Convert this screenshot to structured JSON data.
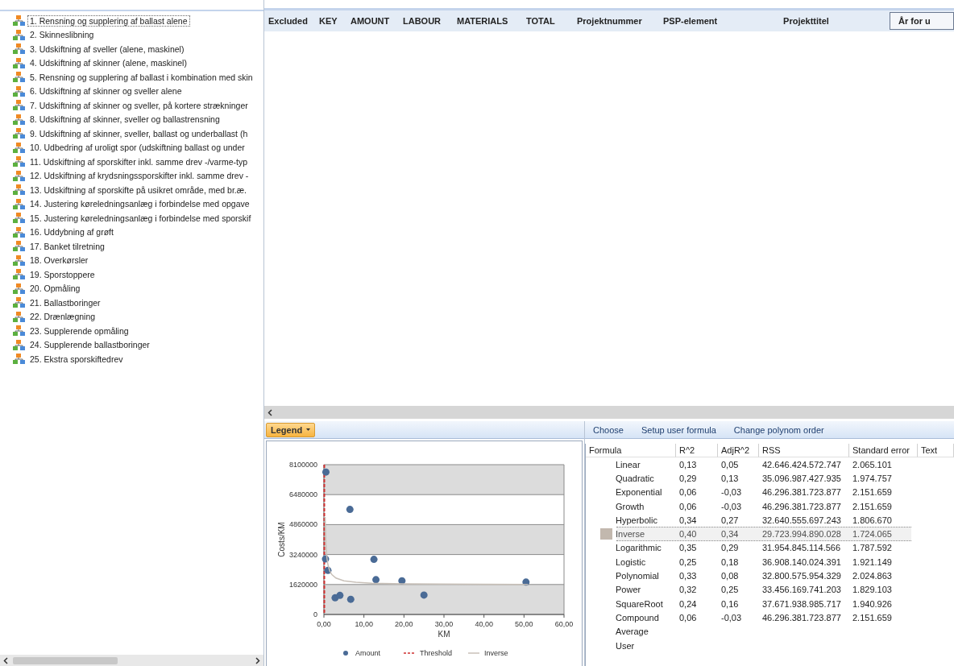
{
  "tree": {
    "items": [
      {
        "label": "1. Rensning og supplering af ballast alene",
        "selected": true
      },
      {
        "label": "2. Skinneslibning",
        "selected": false
      },
      {
        "label": "3. Udskiftning af sveller (alene, maskinel)",
        "selected": false
      },
      {
        "label": "4. Udskiftning af skinner (alene, maskinel)",
        "selected": false
      },
      {
        "label": "5. Rensning og supplering af ballast i kombination med skin",
        "selected": false
      },
      {
        "label": "6. Udskiftning af skinner og sveller alene",
        "selected": false
      },
      {
        "label": "7. Udskiftning af skinner og sveller, på kortere strækninger",
        "selected": false
      },
      {
        "label": "8. Udskiftning af skinner, sveller og ballastrensning",
        "selected": false
      },
      {
        "label": "9. Udskiftning af skinner, sveller, ballast og underballast (h",
        "selected": false
      },
      {
        "label": "10. Udbedring af uroligt spor (udskiftning ballast og under",
        "selected": false
      },
      {
        "label": "11. Udskiftning af sporskifter inkl. samme drev -/varme-typ",
        "selected": false
      },
      {
        "label": "12. Udskiftning af krydsningssporskifter inkl. samme drev -",
        "selected": false
      },
      {
        "label": "13. Udskiftning af sporskifte på usikret område, med br.æ.",
        "selected": false
      },
      {
        "label": "14. Justering køreledningsanlæg i forbindelse med opgave",
        "selected": false
      },
      {
        "label": "15. Justering køreledningsanlæg i forbindelse med sporskif",
        "selected": false
      },
      {
        "label": "16. Uddybning af grøft",
        "selected": false
      },
      {
        "label": "17. Banket tilretning",
        "selected": false
      },
      {
        "label": "18. Overkørsler",
        "selected": false
      },
      {
        "label": "19. Sporstoppere",
        "selected": false
      },
      {
        "label": "20. Opmåling",
        "selected": false
      },
      {
        "label": "21. Ballastboringer",
        "selected": false
      },
      {
        "label": "22. Drænlægning",
        "selected": false
      },
      {
        "label": "23. Supplerende opmåling",
        "selected": false
      },
      {
        "label": "24. Supplerende ballastboringer",
        "selected": false
      },
      {
        "label": "25. Ekstra sporskiftedrev",
        "selected": false
      }
    ]
  },
  "grid": {
    "columns": [
      {
        "label": "Excluded",
        "selected": false
      },
      {
        "label": "KEY",
        "selected": false
      },
      {
        "label": "AMOUNT",
        "selected": false
      },
      {
        "label": "LABOUR",
        "selected": false
      },
      {
        "label": "MATERIALS",
        "selected": false
      },
      {
        "label": "TOTAL",
        "selected": false
      },
      {
        "label": "Projektnummer",
        "selected": false
      },
      {
        "label": "PSP-element",
        "selected": false
      },
      {
        "label": "Projekttitel",
        "selected": false
      },
      {
        "label": "År for u",
        "selected": true
      }
    ]
  },
  "chart_panel": {
    "legend_button": "Legend",
    "chart_data": {
      "type": "scatter",
      "xlabel": "KM",
      "ylabel": "Costs/KM",
      "xlim": [
        0,
        60
      ],
      "ylim": [
        0,
        8100000
      ],
      "xticks": [
        {
          "value": 0,
          "label": "0,00"
        },
        {
          "value": 10,
          "label": "10,00"
        },
        {
          "value": 20,
          "label": "20,00"
        },
        {
          "value": 30,
          "label": "30,00"
        },
        {
          "value": 40,
          "label": "40,00"
        },
        {
          "value": 50,
          "label": "50,00"
        },
        {
          "value": 60,
          "label": "60,00"
        }
      ],
      "yticks": [
        0,
        1620000,
        3240000,
        4860000,
        6480000,
        8100000
      ],
      "series": [
        {
          "name": "Amount",
          "color": "#4a6b96",
          "type": "scatter",
          "x": [
            0.5,
            6.5,
            0.4,
            1.0,
            12.5,
            13.0,
            19.5,
            50.5,
            2.8,
            4.0,
            6.7,
            25.0
          ],
          "values": [
            7700000,
            5680000,
            3000000,
            2380000,
            2980000,
            1880000,
            1820000,
            1750000,
            900000,
            1030000,
            820000,
            1050000
          ]
        },
        {
          "name": "Inverse",
          "color": "#c8c0b8",
          "type": "line",
          "x": [
            0.3,
            0.5,
            0.75,
            1,
            1.5,
            2,
            3,
            5,
            8,
            12,
            20,
            30,
            40,
            51
          ],
          "values": [
            5270000,
            3800000,
            3070000,
            2700000,
            2330000,
            2150000,
            1970000,
            1820000,
            1740000,
            1690000,
            1660000,
            1640000,
            1630000,
            1620000
          ]
        }
      ],
      "grid": true,
      "legend": true,
      "ref_lines": [
        {
          "axis": "x",
          "value": 0.1,
          "label": "Threshold",
          "color": "#d03030"
        }
      ]
    }
  },
  "formula_panel": {
    "toolbar": [
      "Choose",
      "Setup user formula",
      "Change polynom order"
    ],
    "columns": [
      "Formula",
      "R^2",
      "AdjR^2",
      "RSS",
      "Standard error",
      "Text"
    ],
    "rows": [
      {
        "formula": "Linear",
        "r2": "0,13",
        "adj_r2": "0,05",
        "rss": "42.646.424.572.747",
        "std_error": "2.065.101",
        "selected": false
      },
      {
        "formula": "Quadratic",
        "r2": "0,29",
        "adj_r2": "0,13",
        "rss": "35.096.987.427.935",
        "std_error": "1.974.757",
        "selected": false
      },
      {
        "formula": "Exponential",
        "r2": "0,06",
        "adj_r2": "-0,03",
        "rss": "46.296.381.723.877",
        "std_error": "2.151.659",
        "selected": false
      },
      {
        "formula": "Growth",
        "r2": "0,06",
        "adj_r2": "-0,03",
        "rss": "46.296.381.723.877",
        "std_error": "2.151.659",
        "selected": false
      },
      {
        "formula": "Hyperbolic",
        "r2": "0,34",
        "adj_r2": "0,27",
        "rss": "32.640.555.697.243",
        "std_error": "1.806.670",
        "selected": false
      },
      {
        "formula": "Inverse",
        "r2": "0,40",
        "adj_r2": "0,34",
        "rss": "29.723.994.890.028",
        "std_error": "1.724.065",
        "selected": true
      },
      {
        "formula": "Logarithmic",
        "r2": "0,35",
        "adj_r2": "0,29",
        "rss": "31.954.845.114.566",
        "std_error": "1.787.592",
        "selected": false
      },
      {
        "formula": "Logistic",
        "r2": "0,25",
        "adj_r2": "0,18",
        "rss": "36.908.140.024.391",
        "std_error": "1.921.149",
        "selected": false
      },
      {
        "formula": "Polynomial",
        "r2": "0,33",
        "adj_r2": "0,08",
        "rss": "32.800.575.954.329",
        "std_error": "2.024.863",
        "selected": false
      },
      {
        "formula": "Power",
        "r2": "0,32",
        "adj_r2": "0,25",
        "rss": "33.456.169.741.203",
        "std_error": "1.829.103",
        "selected": false
      },
      {
        "formula": "SquareRoot",
        "r2": "0,24",
        "adj_r2": "0,16",
        "rss": "37.671.938.985.717",
        "std_error": "1.940.926",
        "selected": false
      },
      {
        "formula": "Compound",
        "r2": "0,06",
        "adj_r2": "-0,03",
        "rss": "46.296.381.723.877",
        "std_error": "2.151.659",
        "selected": false
      },
      {
        "formula": "Average",
        "selected": false
      },
      {
        "formula": "User",
        "selected": false
      }
    ]
  }
}
